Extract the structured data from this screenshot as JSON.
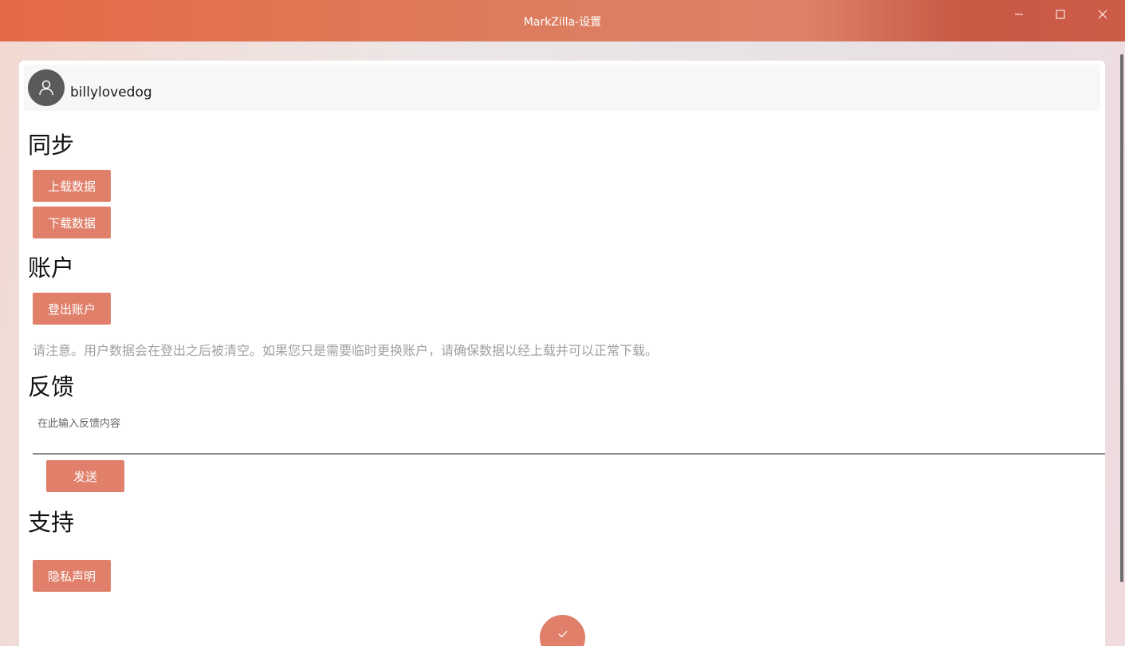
{
  "window": {
    "title": "MarkZilla-设置",
    "minimize_icon": "minimize-icon",
    "maximize_icon": "maximize-icon",
    "close_icon": "close-icon"
  },
  "user": {
    "name": "billylovedog",
    "avatar_icon": "person-icon"
  },
  "sync": {
    "title": "同步",
    "upload_label": "上载数据",
    "download_label": "下载数据"
  },
  "account": {
    "title": "账户",
    "logout_label": "登出账户",
    "note": "请注意。用户数据会在登出之后被清空。如果您只是需要临时更换账户，请确保数据以经上载并可以正常下载。"
  },
  "feedback": {
    "title": "反馈",
    "placeholder": "在此输入反馈内容",
    "send_label": "发送"
  },
  "support": {
    "title": "支持",
    "privacy_label": "隐私声明"
  },
  "fab": {
    "icon": "checkmark-icon"
  },
  "colors": {
    "accent": "#e07f6a",
    "titlebar": "#e06a48"
  }
}
